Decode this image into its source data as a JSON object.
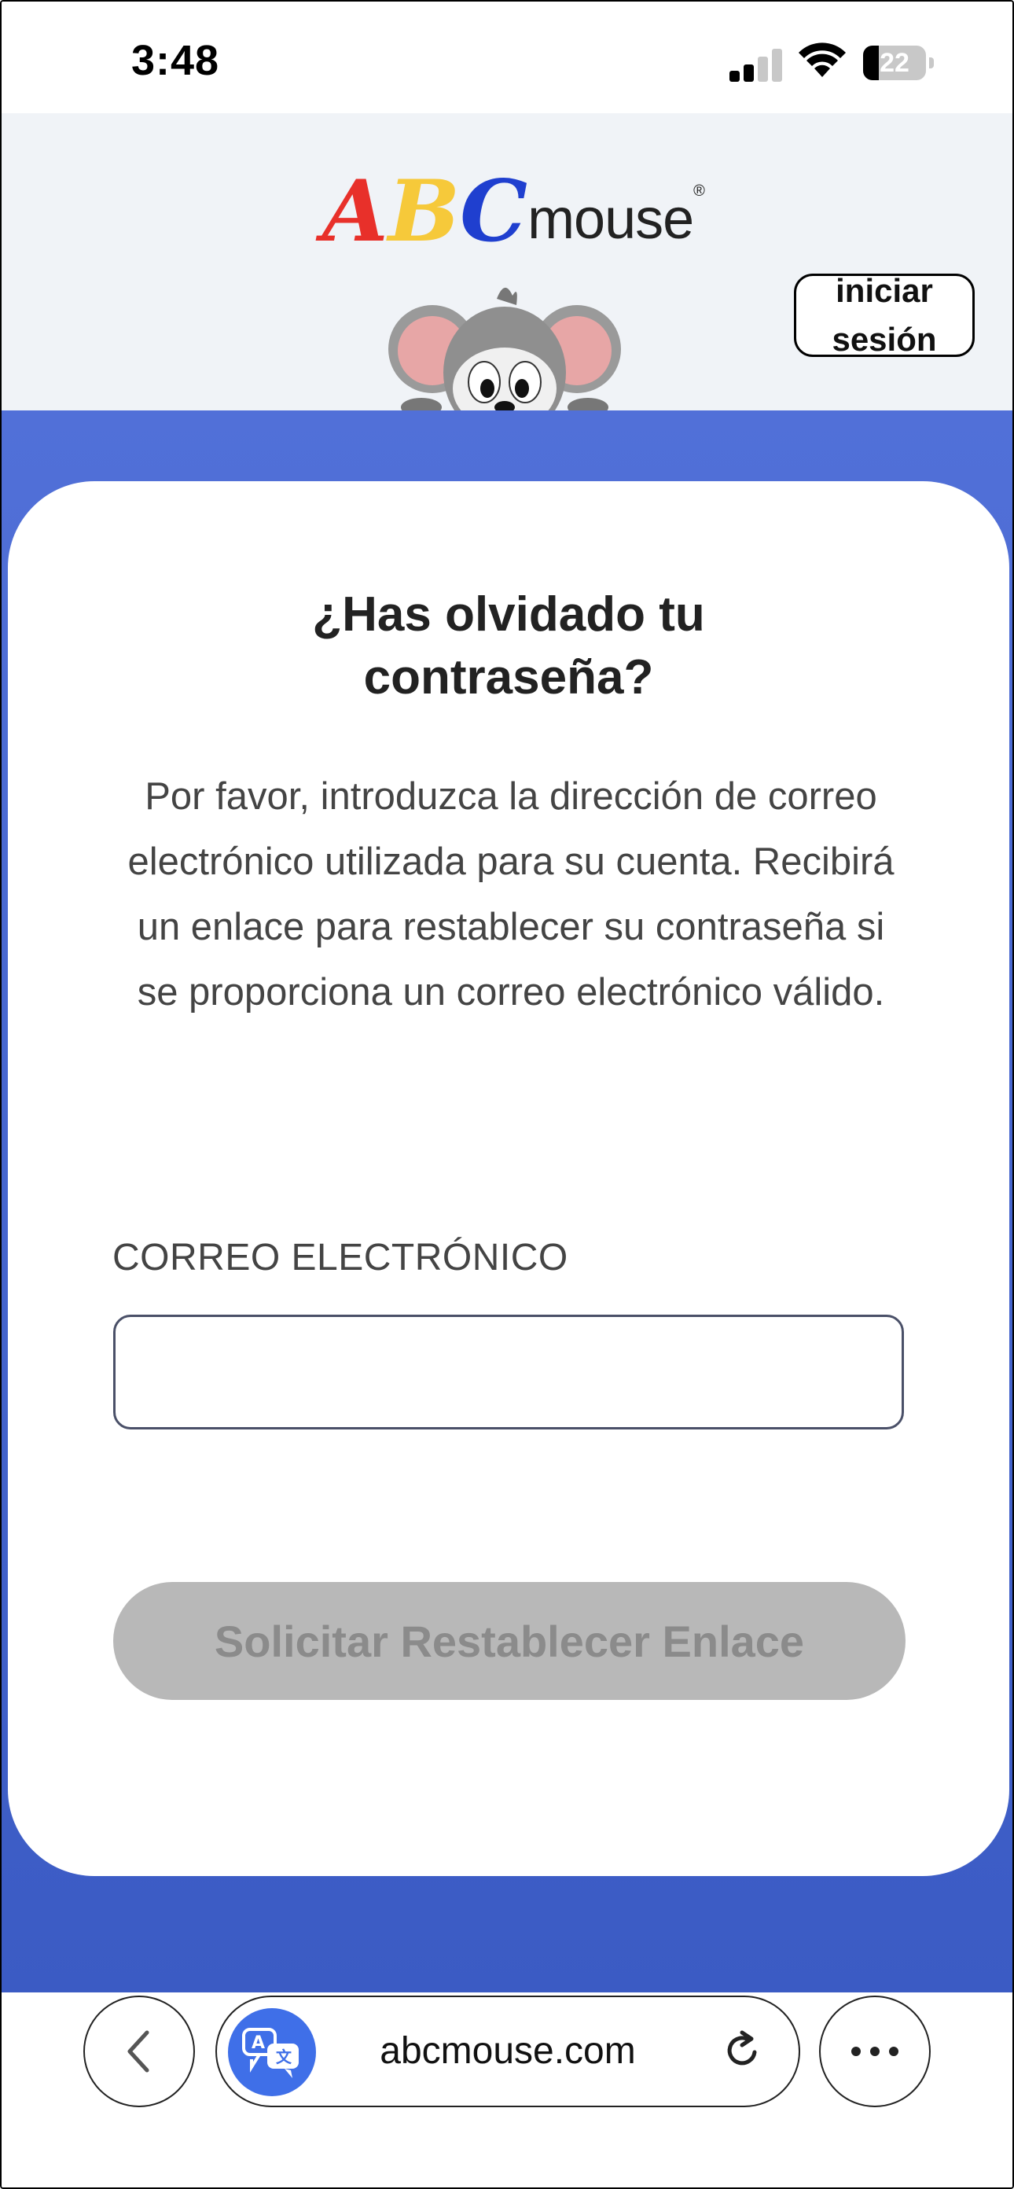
{
  "status_bar": {
    "time": "3:48",
    "battery": "22"
  },
  "header": {
    "logo": {
      "A": "A",
      "B": "B",
      "C": "C",
      "mouse": "mouse",
      "reg": "®"
    },
    "signin_label": "iniciar sesión"
  },
  "form": {
    "title": "¿Has olvidado tu contraseña?",
    "description": "Por favor, introduzca la dirección de correo electrónico utilizada para su cuenta. Recibirá un enlace para restablecer su contraseña si se proporciona un correo electrónico válido.",
    "email_label": "CORREO ELECTRÓNICO",
    "email_value": "",
    "submit_label": "Solicitar Restablecer Enlace"
  },
  "browser": {
    "url": "abcmouse.com"
  },
  "colors": {
    "logo_a": "#e8302a",
    "logo_b": "#f6c93a",
    "logo_c": "#1f3fcf",
    "blue_background": "#4a6ad4",
    "button_disabled": "#b8b8b8",
    "translate": "#3f6fe8"
  },
  "icons": [
    "signal-icon",
    "wifi-icon",
    "battery-icon",
    "mascot-mouse",
    "back-chevron-icon",
    "translate-icon",
    "reload-icon",
    "more-icon"
  ]
}
